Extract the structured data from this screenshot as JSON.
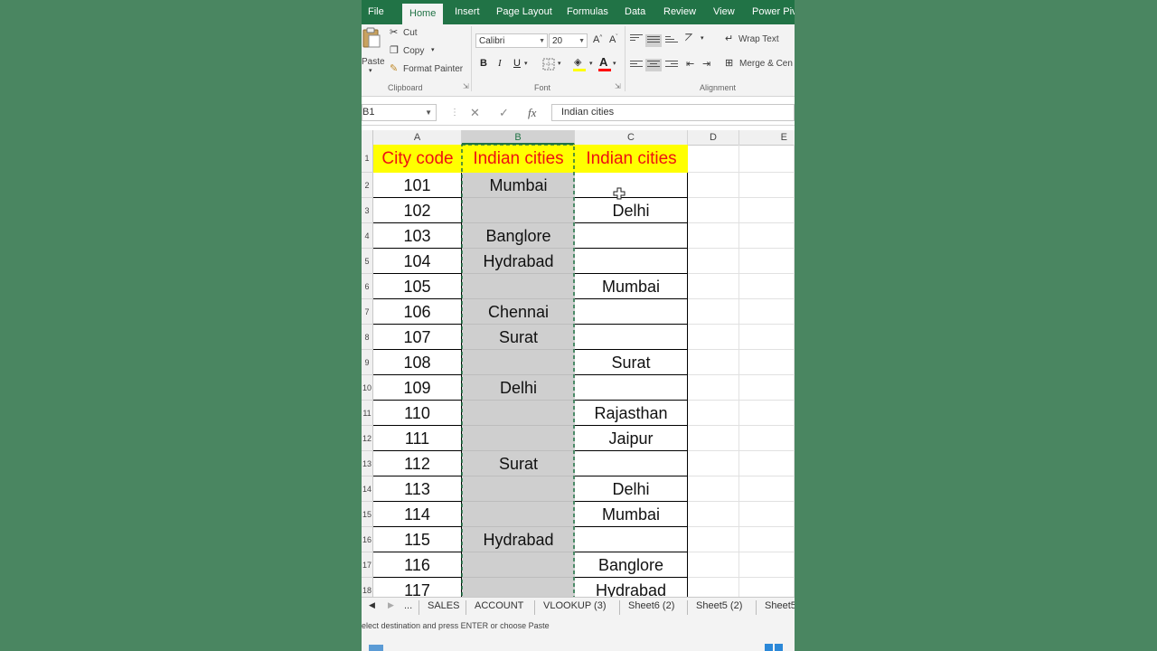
{
  "ribbon": {
    "tabs": [
      "File",
      "Home",
      "Insert",
      "Page Layout",
      "Formulas",
      "Data",
      "Review",
      "View",
      "Power Pivo"
    ],
    "clipboard": {
      "paste": "Paste",
      "cut": "Cut",
      "copy": "Copy",
      "format_painter": "Format Painter",
      "group": "Clipboard"
    },
    "font": {
      "name": "Calibri",
      "size": "20",
      "bold": "B",
      "italic": "I",
      "underline": "U",
      "group": "Font"
    },
    "alignment": {
      "wrap_text": "Wrap Text",
      "merge": "Merge & Cen",
      "group": "Alignment"
    }
  },
  "formula_bar": {
    "name_box": "B1",
    "cancel": "✕",
    "enter": "✓",
    "fx": "fx",
    "content": "Indian cities"
  },
  "grid": {
    "columns": [
      "A",
      "B",
      "C",
      "D",
      "E"
    ],
    "rows": [
      {
        "num": "1",
        "a": "City code",
        "b": "Indian cities",
        "c": "Indian cities"
      },
      {
        "num": "2",
        "a": "101",
        "b": "Mumbai",
        "c": ""
      },
      {
        "num": "3",
        "a": "102",
        "b": "",
        "c": "Delhi"
      },
      {
        "num": "4",
        "a": "103",
        "b": "Banglore",
        "c": ""
      },
      {
        "num": "5",
        "a": "104",
        "b": "Hydrabad",
        "c": ""
      },
      {
        "num": "6",
        "a": "105",
        "b": "",
        "c": "Mumbai"
      },
      {
        "num": "7",
        "a": "106",
        "b": "Chennai",
        "c": ""
      },
      {
        "num": "8",
        "a": "107",
        "b": "Surat",
        "c": ""
      },
      {
        "num": "9",
        "a": "108",
        "b": "",
        "c": "Surat"
      },
      {
        "num": "10",
        "a": "109",
        "b": "Delhi",
        "c": ""
      },
      {
        "num": "11",
        "a": "110",
        "b": "",
        "c": "Rajasthan"
      },
      {
        "num": "12",
        "a": "111",
        "b": "",
        "c": "Jaipur"
      },
      {
        "num": "13",
        "a": "112",
        "b": "Surat",
        "c": ""
      },
      {
        "num": "14",
        "a": "113",
        "b": "",
        "c": "Delhi"
      },
      {
        "num": "15",
        "a": "114",
        "b": "",
        "c": "Mumbai"
      },
      {
        "num": "16",
        "a": "115",
        "b": "Hydrabad",
        "c": ""
      },
      {
        "num": "17",
        "a": "116",
        "b": "",
        "c": "Banglore"
      },
      {
        "num": "18",
        "a": "117",
        "b": "",
        "c": "Hydrabad"
      }
    ]
  },
  "sheet_tabs": [
    "...",
    "SALES",
    "ACCOUNT",
    "VLOOKUP (3)",
    "Sheet6 (2)",
    "Sheet5 (2)",
    "Sheet5"
  ],
  "status": {
    "message": "elect destination and press ENTER or choose Paste"
  },
  "colors": {
    "excel_green": "#217346",
    "header_fill": "#ffff00",
    "header_text": "#ee1111",
    "selection_fill": "#cfcfcf",
    "background": "#4a8661"
  }
}
